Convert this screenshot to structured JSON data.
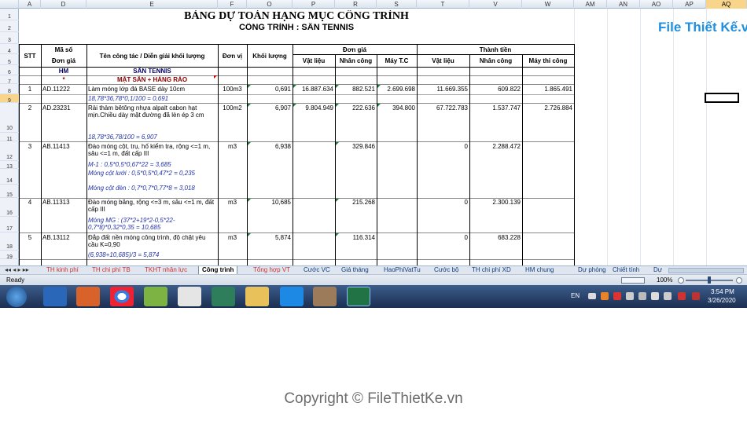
{
  "columns": [
    "A",
    "D",
    "E",
    "F",
    "O",
    "P",
    "R",
    "S",
    "T",
    "V",
    "W",
    "AM",
    "AN",
    "AO",
    "AP",
    "AQ"
  ],
  "rows": [
    "1",
    "2",
    "3",
    "4",
    "5",
    "6",
    "7",
    "8",
    "9",
    "10",
    "11",
    "12",
    "13",
    "14",
    "15",
    "16",
    "17",
    "18",
    "19"
  ],
  "title": "BẢNG DỰ TOÁN HẠNG MỤC CÔNG TRÌNH",
  "subtitle": "CÔNG TRÌNH : SÂN TENNIS",
  "headers": {
    "stt": "STT",
    "ma_so": "Mã số",
    "don_gia_code": "Đơn giá",
    "ten": "Tên công tác / Diễn giải khối lượng",
    "dv": "Đơn vị",
    "kl": "Khối lượng",
    "don_gia": "Đơn giá",
    "thanh_tien": "Thành tiền",
    "vl": "Vật liệu",
    "nc": "Nhân công",
    "mtc": "Máy T.C",
    "vl2": "Vật liệu",
    "nc2": "Nhân công",
    "mtc2": "Máy thi công"
  },
  "row6": {
    "hm": "HM",
    "name": "SÂN TENNIS"
  },
  "row7": {
    "star": "*",
    "name": "MẶT SÂN + HÀNG RÀO"
  },
  "items": [
    {
      "stt": "1",
      "code": "AD.11222",
      "name": "Làm móng lớp đá BASE dày 10cm",
      "unit": "100m3",
      "qty": "0,691",
      "vl": "16.887.634",
      "nc": "882.521",
      "mtc": "2.699.698",
      "tvl": "11.669.355",
      "tnc": "609.822",
      "tmtc": "1.865.491",
      "formula": "18,78*36,78*0,1/100 = 0,691"
    },
    {
      "stt": "2",
      "code": "AD.23231",
      "name": "Rải thảm  bêtông nhựa alpalt cabon hạt mịn.Chiều dày mặt đường đã lèn ép 3 cm",
      "unit": "100m2",
      "qty": "6,907",
      "vl": "9.804.949",
      "nc": "222.636",
      "mtc": "394.800",
      "tvl": "67.722.783",
      "tnc": "1.537.747",
      "tmtc": "2.726.884",
      "formula": "18,78*36,78/100 = 6,907"
    },
    {
      "stt": "3",
      "code": "AB.11413",
      "name": "Đào móng cột, trụ, hố kiểm tra, rộng <=1 m, sâu <=1 m, đất cấp III",
      "unit": "m3",
      "qty": "6,938",
      "nc": "329.846",
      "tvl": "0",
      "tnc": "2.288.472",
      "f1": "M-1 : 0,5*0,5*0,67*22 = 3,685",
      "f2": "Móng cột lưới : 0,5*0,5*0,47*2 = 0,235",
      "f3": "Móng cột đèn : 0,7*0,7*0,77*8 = 3,018"
    },
    {
      "stt": "4",
      "code": "AB.11313",
      "name": "Đào móng băng, rộng <=3 m, sâu <=1 m, đất cấp III",
      "unit": "m3",
      "qty": "10,685",
      "nc": "215.268",
      "tvl": "0",
      "tnc": "2.300.139",
      "formula": "Móng MG : (37*2+19*2-0,5*22-0,7*8)*0,32*0,35 = 10,685"
    },
    {
      "stt": "5",
      "code": "AB.13112",
      "name": "Đắp đất nền móng công trình, độ chặt yêu cầu K=0,90",
      "unit": "m3",
      "qty": "5,874",
      "nc": "116.314",
      "tvl": "0",
      "tnc": "683.228",
      "formula": "(6,938+10,685)/3 = 5,874"
    }
  ],
  "sheet_tabs": [
    "TH kinh phí",
    "TH chi phí TB",
    "TKHT nhân lực",
    "Công trình",
    "Tổng hợp VT",
    "Cước VC",
    "Giá tháng",
    "HaoPhiVatTu",
    "Cước bộ",
    "TH chi phí XD",
    "HM chung",
    "Dự phòng",
    "Chiết tính",
    "Dự"
  ],
  "active_tab": "Công trình",
  "status": "Ready",
  "zoom": "100%",
  "taskbar": {
    "lang": "EN",
    "time": "3:54 PM",
    "date": "3/26/2020"
  },
  "logo": "File Thiết Kế.vn",
  "copyright": "Copyright © FileThietKe.vn"
}
